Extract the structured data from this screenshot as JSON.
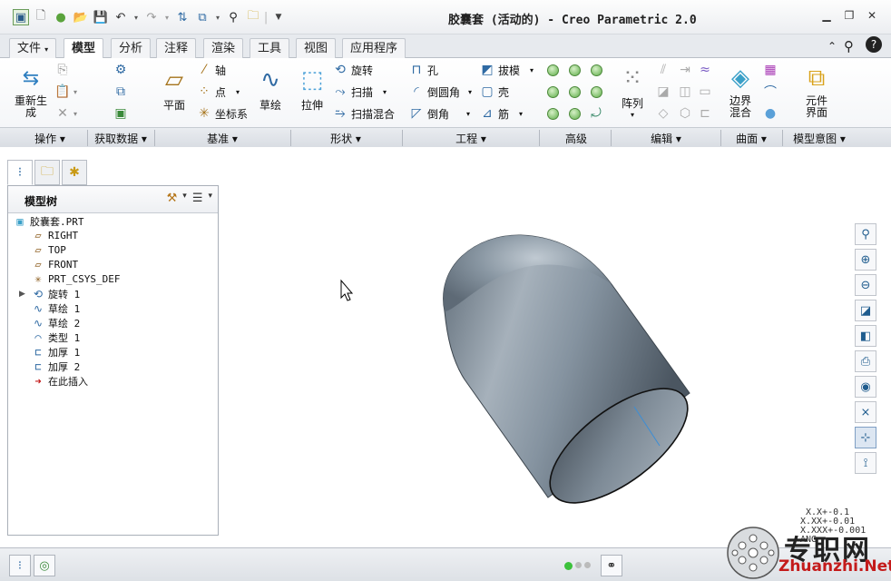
{
  "window": {
    "title": "胶囊套 (活动的) - Creo Parametric 2.0",
    "controls": [
      "minimize",
      "restore",
      "close"
    ]
  },
  "quick_access": [
    "app-icon",
    "new-icon",
    "open-icon",
    "open-folder-icon",
    "save-icon",
    "undo-icon",
    "redo-icon",
    "regenerate-icon",
    "windows-icon",
    "find-icon",
    "close-window-icon",
    "customize-icon"
  ],
  "tabs": {
    "file": "文件",
    "model": "模型",
    "analysis": "分析",
    "annotate": "注释",
    "render": "渲染",
    "tools": "工具",
    "view": "视图",
    "applications": "应用程序"
  },
  "ribbon": {
    "regenerate": "重新生成",
    "plane": "平面",
    "axis": "轴",
    "point": "点",
    "csys": "坐标系",
    "sketch": "草绘",
    "extrude": "拉伸",
    "revolve": "旋转",
    "sweep": "扫描",
    "swept_blend": "扫描混合",
    "hole": "孔",
    "round": "倒圆角",
    "chamfer": "倒角",
    "draft": "拔模",
    "shell": "壳",
    "rib": "筋",
    "pattern": "阵列",
    "boundary_blend": "边界混合",
    "component_interface": "元件界面",
    "groups": {
      "operations": "操作",
      "get_data": "获取数据",
      "datum": "基准",
      "shapes": "形状",
      "engineering": "工程",
      "advanced": "高级",
      "editing": "编辑",
      "surfaces": "曲面",
      "model_intent": "模型意图"
    }
  },
  "model_tree": {
    "title": "模型树",
    "items": [
      {
        "label": "胶囊套.PRT",
        "icon": "part-icon"
      },
      {
        "label": "RIGHT",
        "icon": "datum-plane-icon"
      },
      {
        "label": "TOP",
        "icon": "datum-plane-icon"
      },
      {
        "label": "FRONT",
        "icon": "datum-plane-icon"
      },
      {
        "label": "PRT_CSYS_DEF",
        "icon": "csys-icon"
      },
      {
        "label": "旋转 1",
        "icon": "revolve-icon"
      },
      {
        "label": "草绘 1",
        "icon": "sketch-icon"
      },
      {
        "label": "草绘 2",
        "icon": "sketch-icon"
      },
      {
        "label": "类型 1",
        "icon": "type-icon"
      },
      {
        "label": "加厚 1",
        "icon": "thicken-icon"
      },
      {
        "label": "加厚 2",
        "icon": "thicken-icon"
      },
      {
        "label": "在此插入",
        "icon": "insert-here-icon"
      }
    ]
  },
  "graphics_toolbar": [
    "refit-icon",
    "zoom-in-icon",
    "zoom-out-icon",
    "repaint-icon",
    "display-style-icon",
    "saved-views-icon",
    "view-manager-icon",
    "datum-display-icon",
    "spin-center-icon",
    "annotation-display-icon"
  ],
  "watermark": {
    "line1": "专职网",
    "line2": "Zhuanzhi.Net"
  },
  "corner_text": {
    "l1": "X.X+-0.1",
    "l2": "X.XX+-0.01",
    "l3": "X.XXX+-0.001",
    "l4": "ANG"
  },
  "colors": {
    "accent": "#2f6aa3",
    "model_body": "#8c9aa5",
    "status_green": "#3cc13c"
  }
}
